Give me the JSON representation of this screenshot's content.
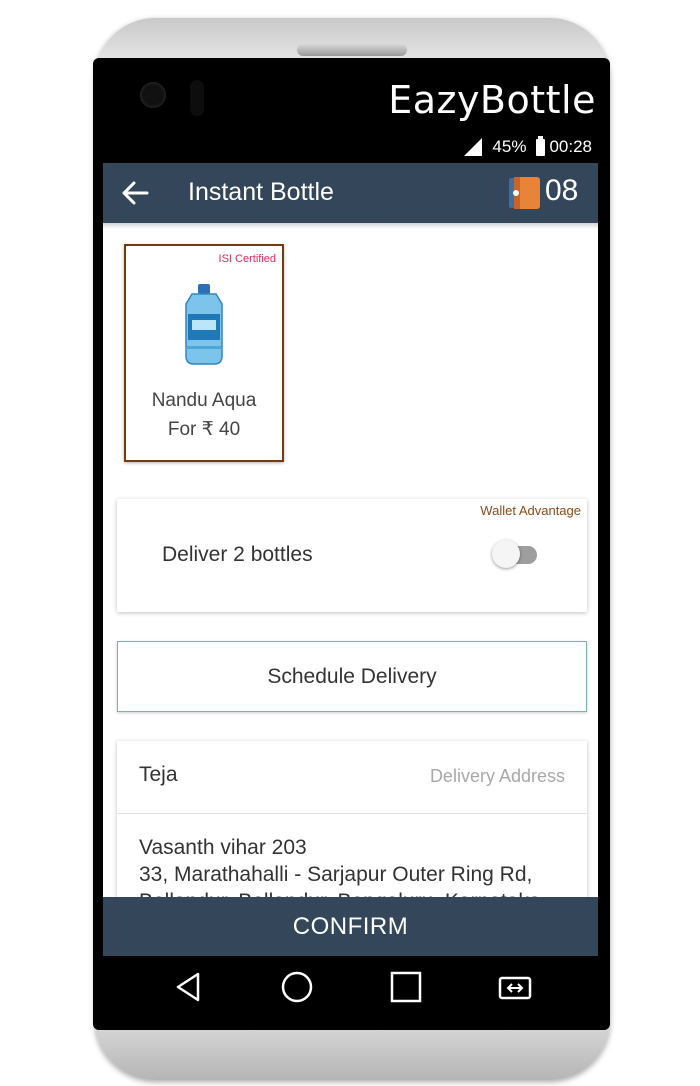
{
  "device": {
    "brand": "EazyBottle"
  },
  "status_bar": {
    "battery": "45%",
    "time": "00:28"
  },
  "app_bar": {
    "title": "Instant Bottle",
    "wallet_count": "08"
  },
  "product": {
    "badge": "ISI Certified",
    "name": "Nandu Aqua",
    "price": "For ₹ 40"
  },
  "deliver_option": {
    "badge": "Wallet Advantage",
    "label": "Deliver 2 bottles",
    "toggle_on": false
  },
  "schedule": {
    "label": "Schedule Delivery"
  },
  "address": {
    "name": "Teja",
    "hint": "Delivery Address",
    "line1": "Vasanth vihar 203",
    "line2": "33, Marathahalli - Sarjapur Outer Ring Rd,",
    "line3": "Bellandur, Bellandur, Bengaluru, Karnataka"
  },
  "confirm": {
    "label": "CONFIRM"
  },
  "colors": {
    "app_bar": "#34475a",
    "badge_pink": "#e0285a",
    "card_border": "#7a3a10",
    "wallet_orange": "#e8843a"
  },
  "icons": [
    "back-arrow-icon",
    "wallet-icon",
    "bottle-icon",
    "nav-back-icon",
    "nav-home-icon",
    "nav-recents-icon",
    "nav-switch-icon"
  ]
}
